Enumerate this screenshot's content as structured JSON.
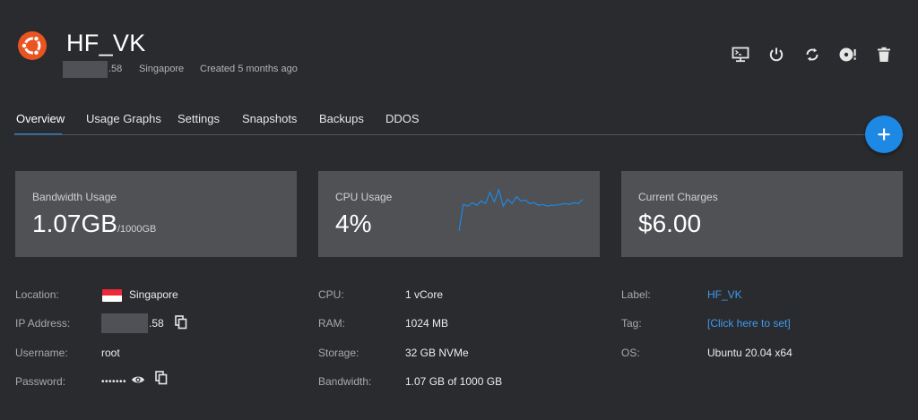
{
  "server": {
    "name": "HF_VK",
    "ip_tail": ".58",
    "location": "Singapore",
    "created": "Created 5 months ago",
    "os_icon": "ubuntu-logo-icon"
  },
  "actions": [
    {
      "name": "console-icon",
      "label": "View Console"
    },
    {
      "name": "power-icon",
      "label": "Server Stop"
    },
    {
      "name": "restart-icon",
      "label": "Server Restart"
    },
    {
      "name": "reinstall-icon",
      "label": "Server Reinstall"
    },
    {
      "name": "trash-icon",
      "label": "Server Destroy"
    }
  ],
  "tabs": [
    {
      "label": "Overview",
      "active": true
    },
    {
      "label": "Usage Graphs"
    },
    {
      "label": "Settings"
    },
    {
      "label": "Snapshots"
    },
    {
      "label": "Backups"
    },
    {
      "label": "DDOS"
    }
  ],
  "fab": {
    "icon": "plus-icon"
  },
  "cards": {
    "bandwidth": {
      "label": "Bandwidth Usage",
      "value": "1.07GB",
      "unit": "/1000GB"
    },
    "cpu": {
      "label": "CPU Usage",
      "value": "4%",
      "sparkline": [
        0,
        62,
        58,
        66,
        60,
        70,
        64,
        90,
        68,
        96,
        58,
        74,
        64,
        80,
        70,
        72,
        64,
        66,
        60,
        62,
        58,
        60,
        60,
        62,
        64,
        62,
        66,
        64,
        74
      ]
    },
    "charges": {
      "label": "Current Charges",
      "value": "$6.00"
    }
  },
  "details": {
    "left": [
      {
        "label": "Location:",
        "value": "Singapore"
      },
      {
        "label": "IP Address:",
        "value": ".58"
      },
      {
        "label": "Username:",
        "value": "root"
      },
      {
        "label": "Password:",
        "value": "•••••••"
      }
    ],
    "middle": [
      {
        "label": "CPU:",
        "value": "1 vCore"
      },
      {
        "label": "RAM:",
        "value": "1024 MB"
      },
      {
        "label": "Storage:",
        "value": "32 GB NVMe"
      },
      {
        "label": "Bandwidth:",
        "value": "1.07 GB of 1000 GB"
      }
    ],
    "right": [
      {
        "label": "Label:",
        "value": "HF_VK"
      },
      {
        "label": "Tag:",
        "value": "[Click here to set]"
      },
      {
        "label": "OS:",
        "value": "Ubuntu 20.04 x64"
      }
    ]
  },
  "colors": {
    "accent": "#1e88e5",
    "link": "#3d9bf0",
    "ubuntu": "#e95420",
    "background": "#2a2b2f",
    "card": "#505154"
  }
}
